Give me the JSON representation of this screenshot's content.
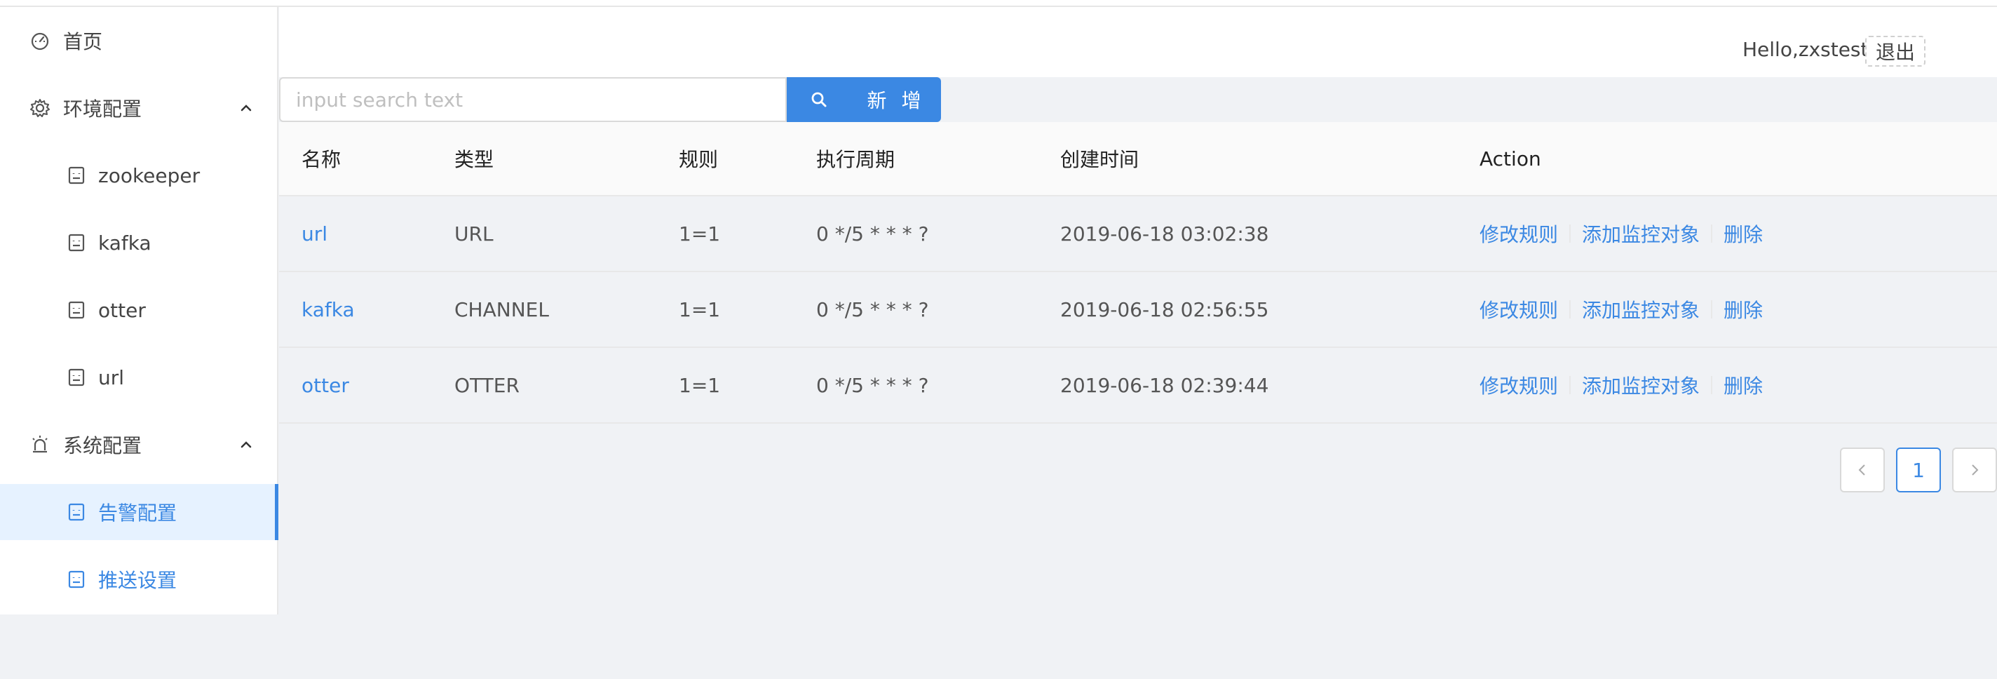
{
  "sidebar": {
    "items": [
      {
        "label": "首页",
        "icon": "dashboard-icon"
      },
      {
        "label": "环境配置",
        "icon": "gear-icon",
        "expanded": true,
        "children": [
          {
            "label": "zookeeper"
          },
          {
            "label": "kafka"
          },
          {
            "label": "otter"
          },
          {
            "label": "url"
          }
        ]
      },
      {
        "label": "系统配置",
        "icon": "alarm-icon",
        "expanded": true,
        "children": [
          {
            "label": "告警配置",
            "active": true
          },
          {
            "label": "推送设置"
          }
        ]
      }
    ]
  },
  "header": {
    "greeting": "Hello,zxstest!",
    "logout_label": "退出"
  },
  "toolbar": {
    "search_placeholder": "input search text",
    "search_value": "",
    "add_label": "新 增"
  },
  "table": {
    "columns": [
      "名称",
      "类型",
      "规则",
      "执行周期",
      "创建时间",
      "Action"
    ],
    "rows": [
      {
        "name": "url",
        "type": "URL",
        "rule": "1=1",
        "cron": "0 */5 * * * ?",
        "created": "2019-06-18 03:02:38"
      },
      {
        "name": "kafka",
        "type": "CHANNEL",
        "rule": "1=1",
        "cron": "0 */5 * * * ?",
        "created": "2019-06-18 02:56:55"
      },
      {
        "name": "otter",
        "type": "OTTER",
        "rule": "1=1",
        "cron": "0 */5 * * * ?",
        "created": "2019-06-18 02:39:44"
      }
    ],
    "actions": [
      "修改规则",
      "添加监控对象",
      "删除"
    ]
  },
  "pagination": {
    "prev": "<",
    "current": "1",
    "next": ">"
  },
  "colors": {
    "accent": "#3b88e3",
    "active_bg": "#e6f2ff",
    "page_bg": "#f0f2f5"
  }
}
